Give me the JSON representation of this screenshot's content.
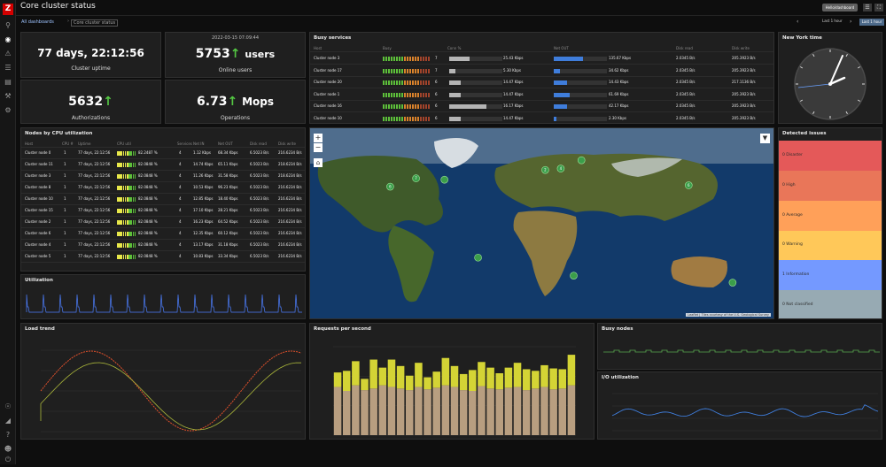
{
  "sidebar": {
    "logo": "Z",
    "icons": [
      "search-icon",
      "eye-icon",
      "alert-icon",
      "list-icon",
      "book-icon",
      "wrench-icon",
      "gear-icon"
    ],
    "bottom_icons": [
      "support-icon",
      "share-icon",
      "help-icon",
      "user-icon",
      "logout-icon"
    ]
  },
  "header": {
    "title": "Core cluster status",
    "dropdown_label": "Hello/dashboard",
    "list_icon": "list-icon",
    "fullscreen_icon": "fullscreen-icon"
  },
  "nav": {
    "crumb1": "All dashboards",
    "crumb2": "Core cluster status",
    "range_label": "Last 1 hour",
    "button_label": "Last 1 hour"
  },
  "kpi": {
    "uptime": {
      "value": "77 days, 22:12:56",
      "label": "Cluster uptime"
    },
    "users": {
      "date": "2022-03-15 07:09:44",
      "value": "5753",
      "unit": "users",
      "label": "Online users"
    },
    "auth": {
      "value": "5632",
      "label": "Authorizations"
    },
    "mops": {
      "value": "6.73",
      "unit": "Mops",
      "label": "Operations"
    }
  },
  "busy_services": {
    "title": "Busy services",
    "headers": [
      "Host",
      "Busy",
      "Conn %",
      "",
      "Net OUT",
      "",
      "Disk read",
      "Disk write"
    ],
    "rows": [
      {
        "host": "Cluster node 3",
        "count": "7",
        "conn": "25.43 Kbps",
        "net": "135.67 Kbps",
        "read": "2.0345 B/s",
        "write": "205.3923 B/s",
        "conn_pct": 0.38,
        "net_pct": 0.55
      },
      {
        "host": "Cluster node 17",
        "count": "7",
        "conn": "5.30 Kbps",
        "net": "34.62 Kbps",
        "read": "2.0345 B/s",
        "write": "205.3923 B/s",
        "conn_pct": 0.12,
        "net_pct": 0.12
      },
      {
        "host": "Cluster node 20",
        "count": "6",
        "conn": "14.47 Kbps",
        "net": "14.43 Kbps",
        "read": "2.0345 B/s",
        "write": "217.1136 B/s",
        "conn_pct": 0.22,
        "net_pct": 0.25
      },
      {
        "host": "Cluster node 1",
        "count": "6",
        "conn": "14.47 Kbps",
        "net": "61.69 Kbps",
        "read": "2.0345 B/s",
        "write": "205.3923 B/s",
        "conn_pct": 0.22,
        "net_pct": 0.3
      },
      {
        "host": "Cluster node 16",
        "count": "6",
        "conn": "16.17 Kbps",
        "net": "42.17 Kbps",
        "read": "2.0345 B/s",
        "write": "205.3923 B/s",
        "conn_pct": 0.7,
        "net_pct": 0.25
      },
      {
        "host": "Cluster node 10",
        "count": "6",
        "conn": "14.47 Kbps",
        "net": "2.30 Kbps",
        "read": "2.0345 B/s",
        "write": "205.3923 B/s",
        "conn_pct": 0.22,
        "net_pct": 0.05
      }
    ]
  },
  "clock": {
    "title": "New York time"
  },
  "nodes": {
    "title": "Nodes by CPU utilization",
    "headers": [
      "Host",
      "CPU #",
      "Uptime",
      "CPU util",
      "",
      "Services",
      "Net IN",
      "Net OUT",
      "Disk read",
      "Disk write"
    ],
    "rows": [
      {
        "host": "Cluster node 0",
        "cpu": "1",
        "uptime": "77 days, 22:12:56",
        "pct": "82.2487 %",
        "svc": "4",
        "net_in": "1.12 Kbps",
        "net_out": "68.34 Kbps",
        "read": "6.5023 B/s",
        "write": "216.6234 B/s"
      },
      {
        "host": "Cluster node 11",
        "cpu": "1",
        "uptime": "77 days, 22:12:56",
        "pct": "82.0848 %",
        "svc": "4",
        "net_in": "14.74 Kbps",
        "net_out": "65.11 Kbps",
        "read": "6.5023 B/s",
        "write": "218.6234 B/s"
      },
      {
        "host": "Cluster node 3",
        "cpu": "1",
        "uptime": "77 days, 22:12:56",
        "pct": "82.0848 %",
        "svc": "4",
        "net_in": "11.26 Kbps",
        "net_out": "31.58 Kbps",
        "read": "6.5023 B/s",
        "write": "218.6234 B/s"
      },
      {
        "host": "Cluster node 8",
        "cpu": "1",
        "uptime": "77 days, 22:12:56",
        "pct": "82.0848 %",
        "svc": "4",
        "net_in": "10.53 Kbps",
        "net_out": "96.23 Kbps",
        "read": "6.5023 B/s",
        "write": "216.6234 B/s"
      },
      {
        "host": "Cluster node 10",
        "cpu": "1",
        "uptime": "77 days, 22:12:56",
        "pct": "82.0848 %",
        "svc": "4",
        "net_in": "12.85 Kbps",
        "net_out": "18.40 Kbps",
        "read": "6.5023 B/s",
        "write": "216.6234 B/s"
      },
      {
        "host": "Cluster node 15",
        "cpu": "1",
        "uptime": "77 days, 22:12:56",
        "pct": "82.0848 %",
        "svc": "4",
        "net_in": "17.10 Kbps",
        "net_out": "28.21 Kbps",
        "read": "6.5023 B/s",
        "write": "216.6234 B/s"
      },
      {
        "host": "Cluster node 2",
        "cpu": "1",
        "uptime": "77 days, 22:12:56",
        "pct": "82.0848 %",
        "svc": "4",
        "net_in": "16.23 Kbps",
        "net_out": "64.52 Kbps",
        "read": "6.5023 B/s",
        "write": "216.6234 B/s"
      },
      {
        "host": "Cluster node 6",
        "cpu": "1",
        "uptime": "77 days, 22:12:56",
        "pct": "82.0848 %",
        "svc": "4",
        "net_in": "12.35 Kbps",
        "net_out": "60.12 Kbps",
        "read": "6.5023 B/s",
        "write": "216.6234 B/s"
      },
      {
        "host": "Cluster node 4",
        "cpu": "1",
        "uptime": "77 days, 22:12:56",
        "pct": "82.0848 %",
        "svc": "4",
        "net_in": "13.17 Kbps",
        "net_out": "31.18 Kbps",
        "read": "6.5023 B/s",
        "write": "216.6234 B/s"
      },
      {
        "host": "Cluster node 5",
        "cpu": "1",
        "uptime": "77 days, 22:12:56",
        "pct": "82.0848 %",
        "svc": "4",
        "net_in": "10.83 Kbps",
        "net_out": "33.34 Kbps",
        "read": "6.5023 B/s",
        "write": "216.6234 B/s"
      }
    ]
  },
  "utilization": {
    "title": "Utilization"
  },
  "map": {
    "title": "",
    "attribution": "Leaflet | Tiles courtesy of the U.S. Geological Survey",
    "markers": [
      {
        "label": "7",
        "lon": -98,
        "lat": 42
      },
      {
        "label": "6",
        "lon": -118,
        "lat": 36
      },
      {
        "label": "2",
        "lon": 2,
        "lat": 48
      },
      {
        "label": "4",
        "lon": 14,
        "lat": 49
      },
      {
        "label": "",
        "lon": 30,
        "lat": 55
      },
      {
        "label": "6",
        "lon": 113,
        "lat": 37
      },
      {
        "label": "",
        "lon": -76,
        "lat": 41
      },
      {
        "label": "",
        "lon": -50,
        "lat": -15
      },
      {
        "label": "",
        "lon": 24,
        "lat": -28
      },
      {
        "label": "",
        "lon": 147,
        "lat": -33
      }
    ]
  },
  "issues": {
    "title": "Detected issues",
    "items": [
      {
        "label": "0 Disaster",
        "color": "#e45959"
      },
      {
        "label": "0 High",
        "color": "#e97659"
      },
      {
        "label": "0 Average",
        "color": "#ffa059"
      },
      {
        "label": "0 Warning",
        "color": "#ffc859"
      },
      {
        "label": "1 Information",
        "color": "#7499ff"
      },
      {
        "label": "0 Not classified",
        "color": "#97aab3"
      }
    ]
  },
  "load_trend": {
    "title": "Load trend"
  },
  "requests": {
    "title": "Requests per second"
  },
  "busy_nodes": {
    "title": "Busy nodes"
  },
  "io_util": {
    "title": "I/O utilization"
  },
  "chart_data": [
    {
      "type": "bar",
      "title": "Requests per second",
      "series": [
        {
          "values": [
            60,
            55,
            62,
            56,
            58,
            62,
            60,
            58,
            56,
            60,
            57,
            59,
            62,
            60,
            56,
            55,
            61,
            58,
            57,
            59,
            60,
            56,
            58,
            60,
            57,
            58,
            62
          ]
        },
        {
          "values": [
            18,
            25,
            30,
            14,
            36,
            22,
            34,
            28,
            18,
            30,
            15,
            20,
            34,
            26,
            20,
            26,
            30,
            26,
            20,
            25,
            30,
            26,
            22,
            27,
            26,
            24,
            38
          ]
        }
      ],
      "ylim": [
        0,
        110
      ]
    }
  ]
}
